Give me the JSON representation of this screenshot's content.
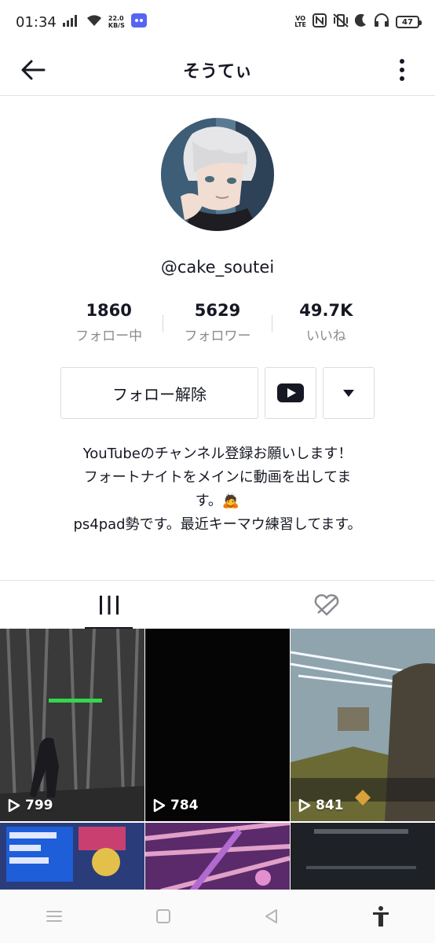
{
  "status_bar": {
    "time": "01:34",
    "net_speed_value": "22.0",
    "net_speed_unit": "KB/S",
    "volte": "VO",
    "volte_sub": "LTE",
    "battery": "47"
  },
  "header": {
    "title": "そうてぃ"
  },
  "profile": {
    "username": "@cake_soutei",
    "stats": [
      {
        "value": "1860",
        "label": "フォロー中"
      },
      {
        "value": "5629",
        "label": "フォロワー"
      },
      {
        "value": "49.7K",
        "label": "いいね"
      }
    ],
    "follow_button": "フォロー解除",
    "bio_lines": [
      "YouTubeのチャンネル登録お願いします！",
      "フォートナイトをメインに動画を出してま",
      "す。🙇",
      "ps4pad勢です。最近キーマウ練習してます。"
    ]
  },
  "videos": [
    {
      "views": "799"
    },
    {
      "views": "784"
    },
    {
      "views": "841"
    },
    {
      "views": ""
    },
    {
      "views": ""
    },
    {
      "views": ""
    }
  ],
  "colors": {
    "accent": "#161823",
    "muted": "#8a8b91",
    "border": "#e3e3e4"
  }
}
